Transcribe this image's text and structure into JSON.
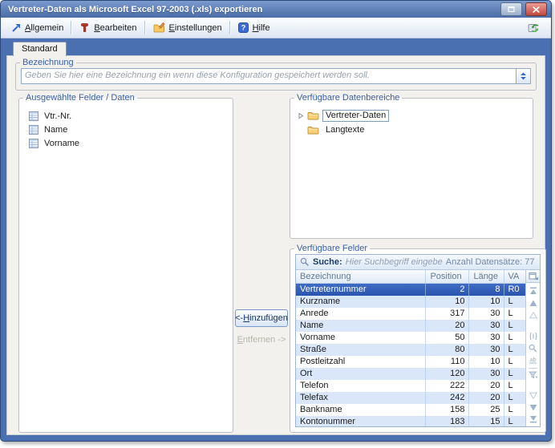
{
  "window": {
    "title": "Vertreter-Daten als Microsoft Excel 97-2003 (.xls) exportieren"
  },
  "toolbar": {
    "items": [
      {
        "accel": "A",
        "rest": "llgemein"
      },
      {
        "accel": "B",
        "rest": "earbeiten"
      },
      {
        "accel": "E",
        "rest": "instellungen"
      },
      {
        "accel": "H",
        "rest": "ilfe"
      }
    ]
  },
  "tabs": {
    "standard": "Standard"
  },
  "bezeichnung": {
    "legend": "Bezeichnung",
    "placeholder": "Geben Sie hier eine Bezeichnung ein wenn diese Konfiguration gespeichert werden soll."
  },
  "selected_fields": {
    "legend": "Ausgewählte Felder / Daten",
    "items": [
      "Vtr.-Nr.",
      "Name",
      "Vorname"
    ]
  },
  "transfer": {
    "add_prefix": "<- ",
    "add_accel": "H",
    "add_rest": "inzufügen",
    "remove_accel": "E",
    "remove_rest": "ntfernen ->"
  },
  "data_areas": {
    "legend": "Verfügbare Datenbereiche",
    "nodes": [
      {
        "label": "Vertreter-Daten",
        "expandable": true,
        "selected": true
      },
      {
        "label": "Langtexte",
        "expandable": false,
        "selected": false
      }
    ]
  },
  "available_fields": {
    "legend": "Verfügbare Felder",
    "search_label": "Suche:",
    "search_placeholder": "Hier Suchbegriff eingebe",
    "records_count_label": "Anzahl Datensätze: 77",
    "columns": [
      "Bezeichnung",
      "Position",
      "Länge",
      "VA"
    ],
    "rows": [
      {
        "bezeichnung": "Vertreternummer",
        "position": "2",
        "laenge": "8",
        "va": "R0",
        "selected": true
      },
      {
        "bezeichnung": "Kurzname",
        "position": "10",
        "laenge": "10",
        "va": "L"
      },
      {
        "bezeichnung": "Anrede",
        "position": "317",
        "laenge": "30",
        "va": "L"
      },
      {
        "bezeichnung": "Name",
        "position": "20",
        "laenge": "30",
        "va": "L"
      },
      {
        "bezeichnung": "Vorname",
        "position": "50",
        "laenge": "30",
        "va": "L"
      },
      {
        "bezeichnung": "Straße",
        "position": "80",
        "laenge": "30",
        "va": "L"
      },
      {
        "bezeichnung": "Postleitzahl",
        "position": "110",
        "laenge": "10",
        "va": "L"
      },
      {
        "bezeichnung": "Ort",
        "position": "120",
        "laenge": "30",
        "va": "L"
      },
      {
        "bezeichnung": "Telefon",
        "position": "222",
        "laenge": "20",
        "va": "L"
      },
      {
        "bezeichnung": "Telefax",
        "position": "242",
        "laenge": "20",
        "va": "L"
      },
      {
        "bezeichnung": "Bankname",
        "position": "158",
        "laenge": "25",
        "va": "L"
      },
      {
        "bezeichnung": "Kontonummer",
        "position": "183",
        "laenge": "15",
        "va": "L"
      }
    ]
  },
  "colors": {
    "window_chrome": "#4a70b2",
    "selection_blue": "#2d57b0",
    "row_stripe_blue": "#d9e7f8",
    "close_button_red": "#bf4a41",
    "legend_blue": "#3a5ea8"
  }
}
